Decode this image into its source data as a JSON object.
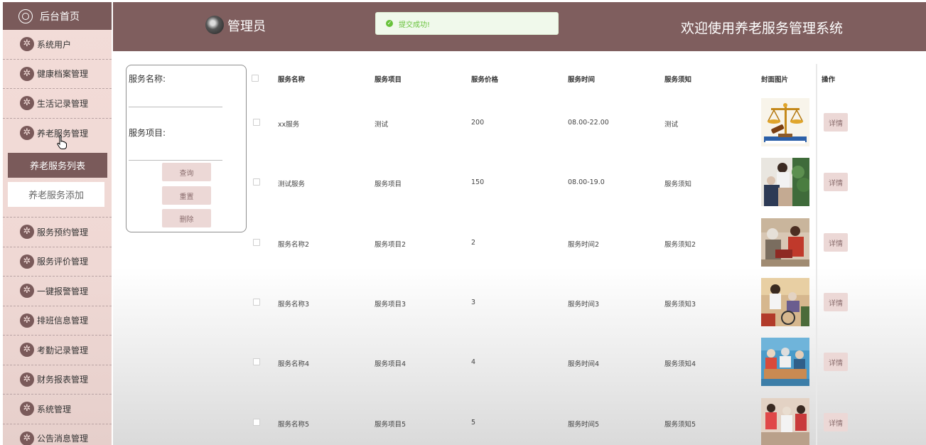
{
  "sidebar": {
    "home_label": "后台首页",
    "items": [
      {
        "label": "系统用户"
      },
      {
        "label": "健康档案管理"
      },
      {
        "label": "生活记录管理"
      },
      {
        "label": "养老服务管理"
      },
      {
        "label": "服务预约管理"
      },
      {
        "label": "服务评价管理"
      },
      {
        "label": "一键报警管理"
      },
      {
        "label": "排班信息管理"
      },
      {
        "label": "考勤记录管理"
      },
      {
        "label": "财务报表管理"
      },
      {
        "label": "系统管理"
      },
      {
        "label": "公告消息管理"
      }
    ],
    "submenu": {
      "active": "养老服务列表",
      "add": "养老服务添加"
    }
  },
  "header": {
    "admin_name": "管理员",
    "toast": "提交成功!",
    "title": "欢迎使用养老服务管理系统"
  },
  "search": {
    "name_label": "服务名称:",
    "name_value": "",
    "item_label": "服务项目:",
    "item_value": "",
    "query_label": "查询",
    "reset_label": "重置",
    "delete_label": "删除"
  },
  "table": {
    "headers": [
      "服务名称",
      "服务项目",
      "服务价格",
      "服务时间",
      "服务须知",
      "封面图片",
      "操作"
    ],
    "rows": [
      {
        "name": "xx服务",
        "item": "测试",
        "price": "200",
        "time": "08.00-22.00",
        "notice": "测试",
        "image": "scales",
        "action": "详情"
      },
      {
        "name": "测试服务",
        "item": "服务项目",
        "price": "150",
        "time": "08.00-19.0",
        "notice": "服务须知",
        "image": "nurse-elder",
        "action": "详情"
      },
      {
        "name": "服务名称2",
        "item": "服务项目2",
        "price": "2",
        "time": "服务时间2",
        "notice": "服务须知2",
        "image": "elder-care",
        "action": "详情"
      },
      {
        "name": "服务名称3",
        "item": "服务项目3",
        "price": "3",
        "time": "服务时间3",
        "notice": "服务须知3",
        "image": "wheelchair",
        "action": "详情"
      },
      {
        "name": "服务名称4",
        "item": "服务项目4",
        "price": "4",
        "time": "服务时间4",
        "notice": "服务须知4",
        "image": "group-table",
        "action": "详情"
      },
      {
        "name": "服务名称5",
        "item": "服务项目5",
        "price": "5",
        "time": "服务时间5",
        "notice": "服务须知5",
        "image": "gathering",
        "action": "详情"
      }
    ]
  },
  "colors": {
    "brand": "#7f5e5e",
    "sidebar_bg": "#f3dcd8",
    "button_bg": "#ecd8d6",
    "success": "#67c23a"
  }
}
